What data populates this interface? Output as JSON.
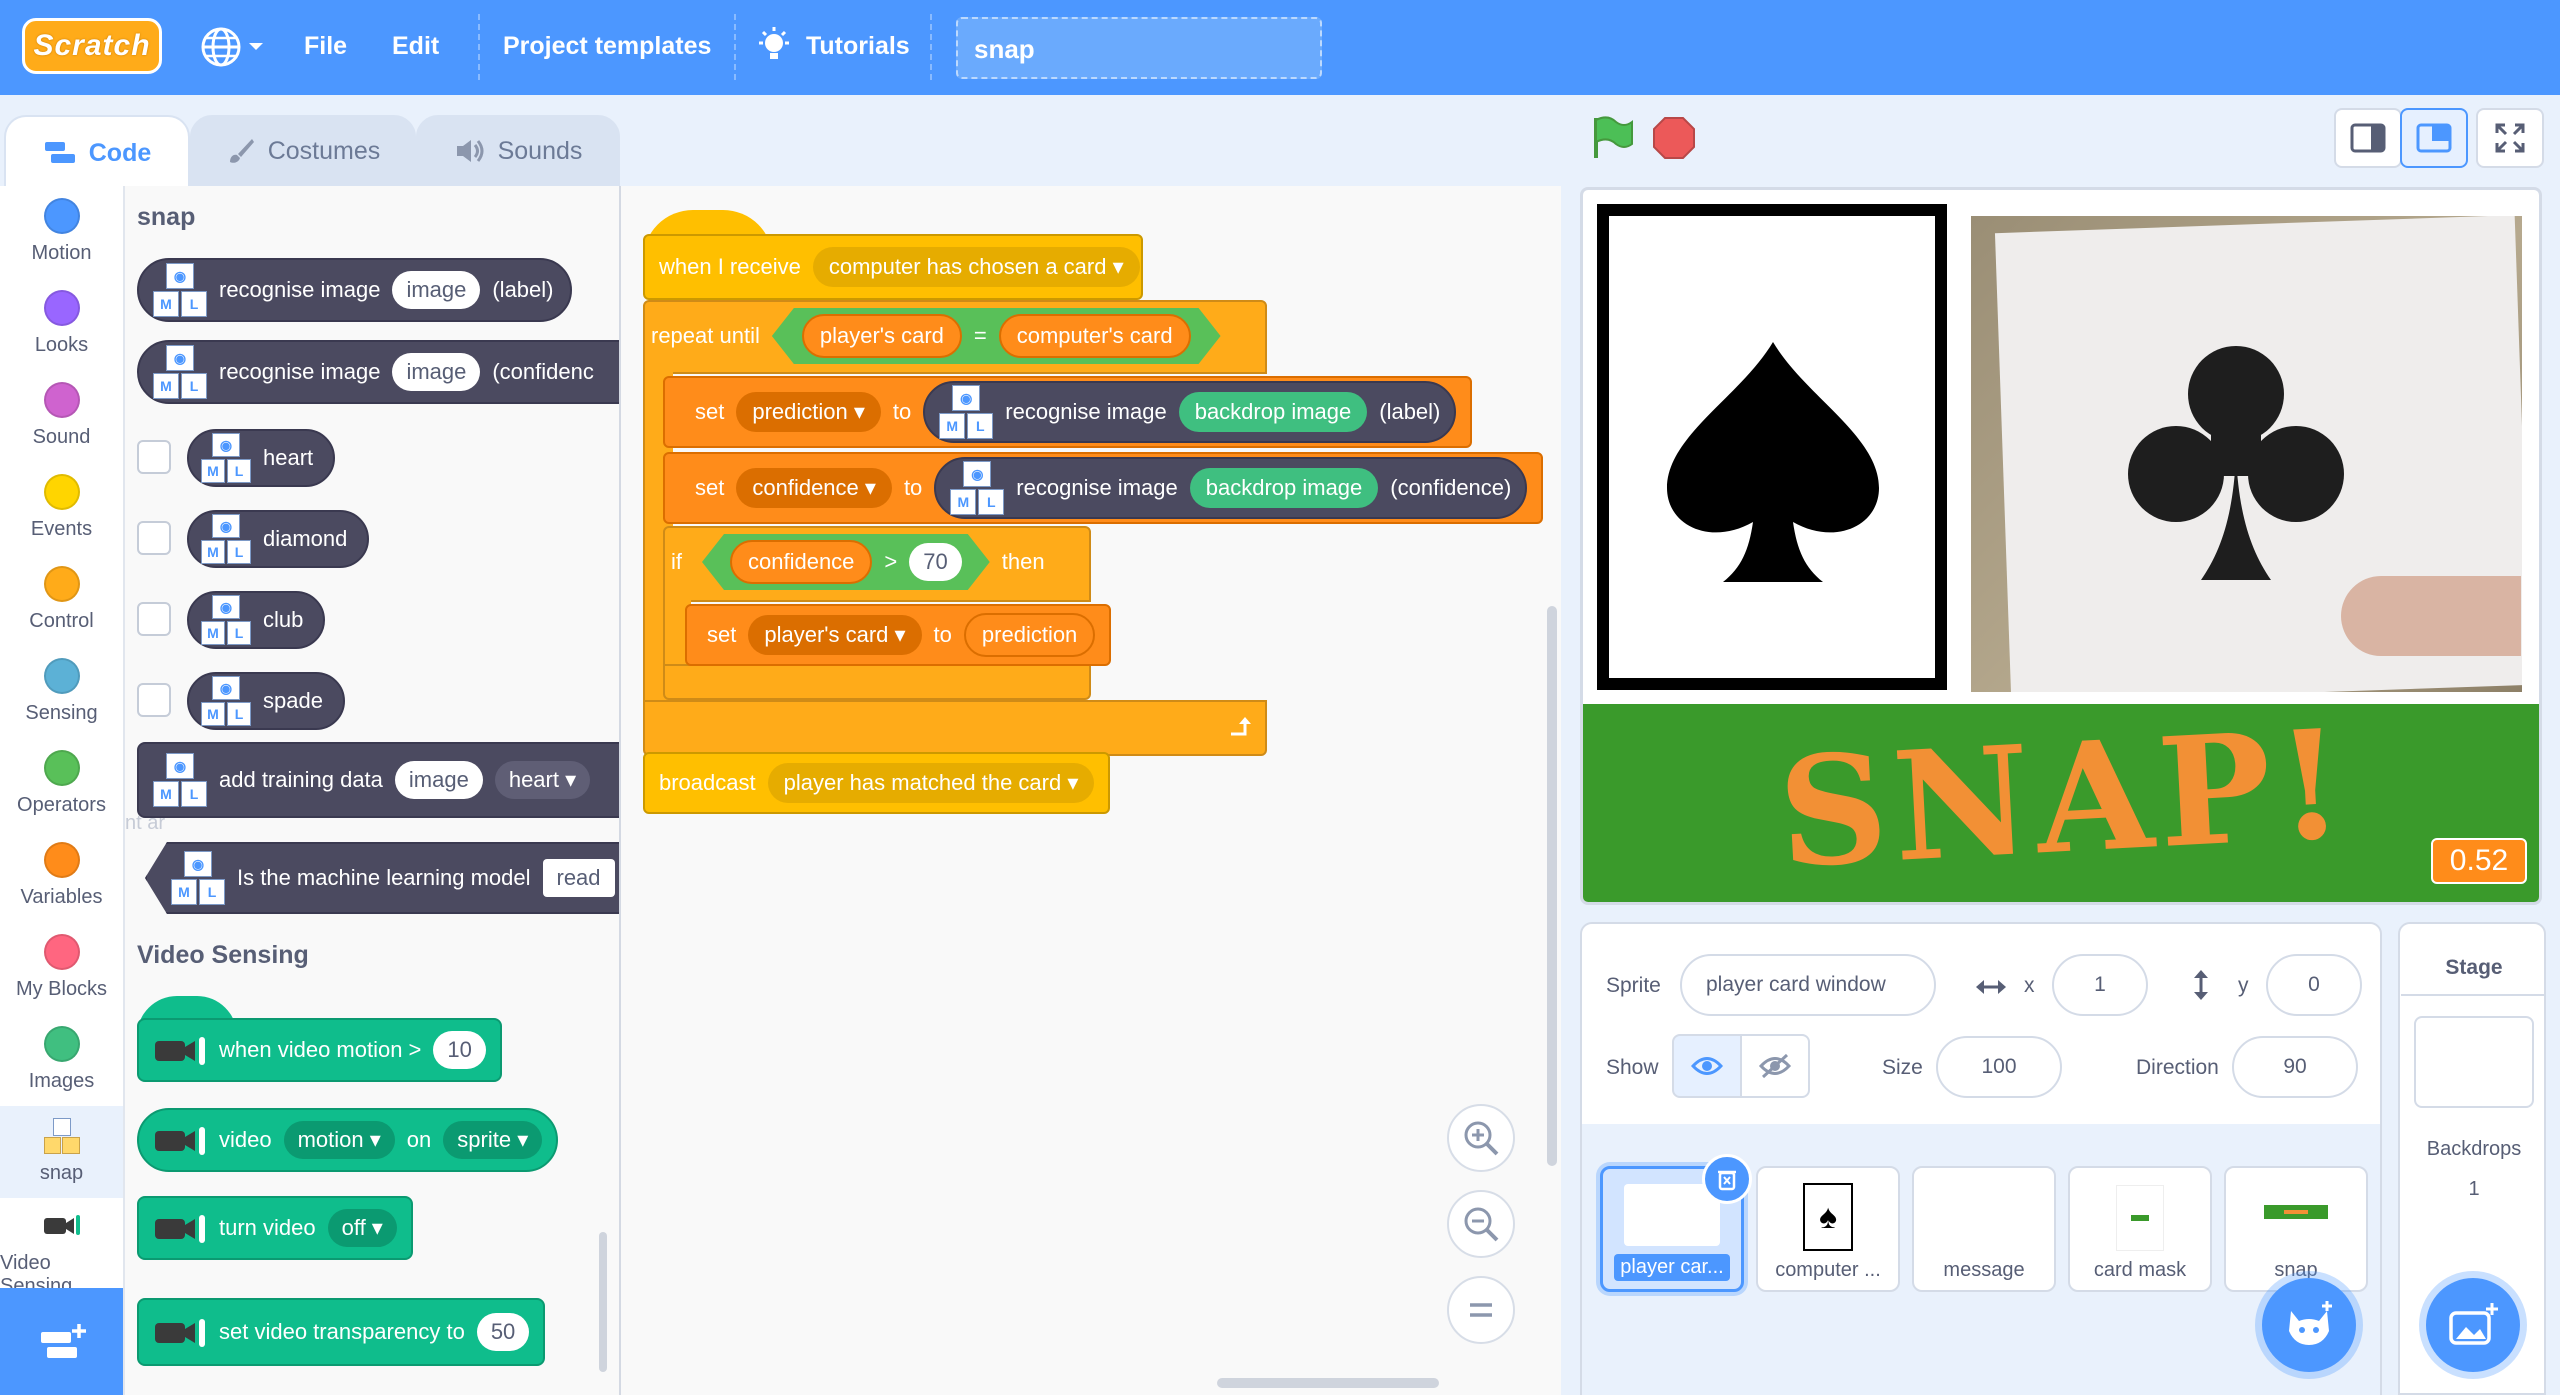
{
  "menu": {
    "logo": "Scratch",
    "file": "File",
    "edit": "Edit",
    "project_templates": "Project templates",
    "tutorials": "Tutorials",
    "project_title": "snap"
  },
  "tabs": {
    "code": "Code",
    "costumes": "Costumes",
    "sounds": "Sounds"
  },
  "categories": [
    {
      "label": "Motion",
      "color": "#4c97ff"
    },
    {
      "label": "Looks",
      "color": "#9966ff"
    },
    {
      "label": "Sound",
      "color": "#cf63cf"
    },
    {
      "label": "Events",
      "color": "#ffd500"
    },
    {
      "label": "Control",
      "color": "#ffab19"
    },
    {
      "label": "Sensing",
      "color": "#5cb1d6"
    },
    {
      "label": "Operators",
      "color": "#59c059"
    },
    {
      "label": "Variables",
      "color": "#ff8c1a"
    },
    {
      "label": "My Blocks",
      "color": "#ff6680"
    },
    {
      "label": "Images",
      "color": "#40bf80"
    },
    {
      "label": "snap",
      "color": "#4b4a60"
    },
    {
      "label": "Video Sensing",
      "color": "#0fbd8c"
    }
  ],
  "flyout": {
    "snap_heading": "snap",
    "recognise_image": "recognise image",
    "image": "image",
    "label": "(label)",
    "confidence_cut": "(confidenc",
    "labels": [
      "heart",
      "diamond",
      "club",
      "spade"
    ],
    "add_training_data": "add training data",
    "heart": "heart",
    "is_model": "Is the machine learning model",
    "ready_cut": "read",
    "ghost_text": "nt ar",
    "video_heading": "Video Sensing",
    "when_video_motion": "when video motion >",
    "motion_value": "10",
    "video": "video",
    "motion": "motion",
    "on": "on",
    "sprite": "sprite",
    "turn_video": "turn video",
    "off": "off",
    "set_video_transparency": "set video transparency to",
    "transparency_value": "50"
  },
  "script": {
    "when_i_receive": "when I receive",
    "msg1": "computer has chosen a card",
    "repeat_until": "repeat until",
    "players_card": "player's card",
    "equals": "=",
    "computers_card": "computer's card",
    "set": "set",
    "prediction": "prediction",
    "to": "to",
    "recognise_image": "recognise image",
    "backdrop_image": "backdrop image",
    "label": "(label)",
    "confidence": "confidence",
    "confidence_reporter": "(confidence)",
    "if": "if",
    "gt": ">",
    "threshold": "70",
    "then": "then",
    "broadcast": "broadcast",
    "msg2": "player has matched the card"
  },
  "stage": {
    "snap_text": "SNAP!",
    "monitor_value": "0.52"
  },
  "sprite_info": {
    "sprite_label": "Sprite",
    "sprite_name": "player card window",
    "x_label": "x",
    "x": "1",
    "y_label": "y",
    "y": "0",
    "show_label": "Show",
    "size_label": "Size",
    "size": "100",
    "direction_label": "Direction",
    "direction": "90"
  },
  "sprites": [
    "player car...",
    "computer ...",
    "message",
    "card mask",
    "snap"
  ],
  "stage_pane": {
    "title": "Stage",
    "backdrops_label": "Backdrops",
    "backdrops_count": "1"
  },
  "colors": {
    "accent": "#4c97ff",
    "ml_block": "#4b4a60",
    "video_block": "#0fbd8c",
    "stage_green": "#3a9a2b",
    "snap_orange": "#f29035"
  }
}
